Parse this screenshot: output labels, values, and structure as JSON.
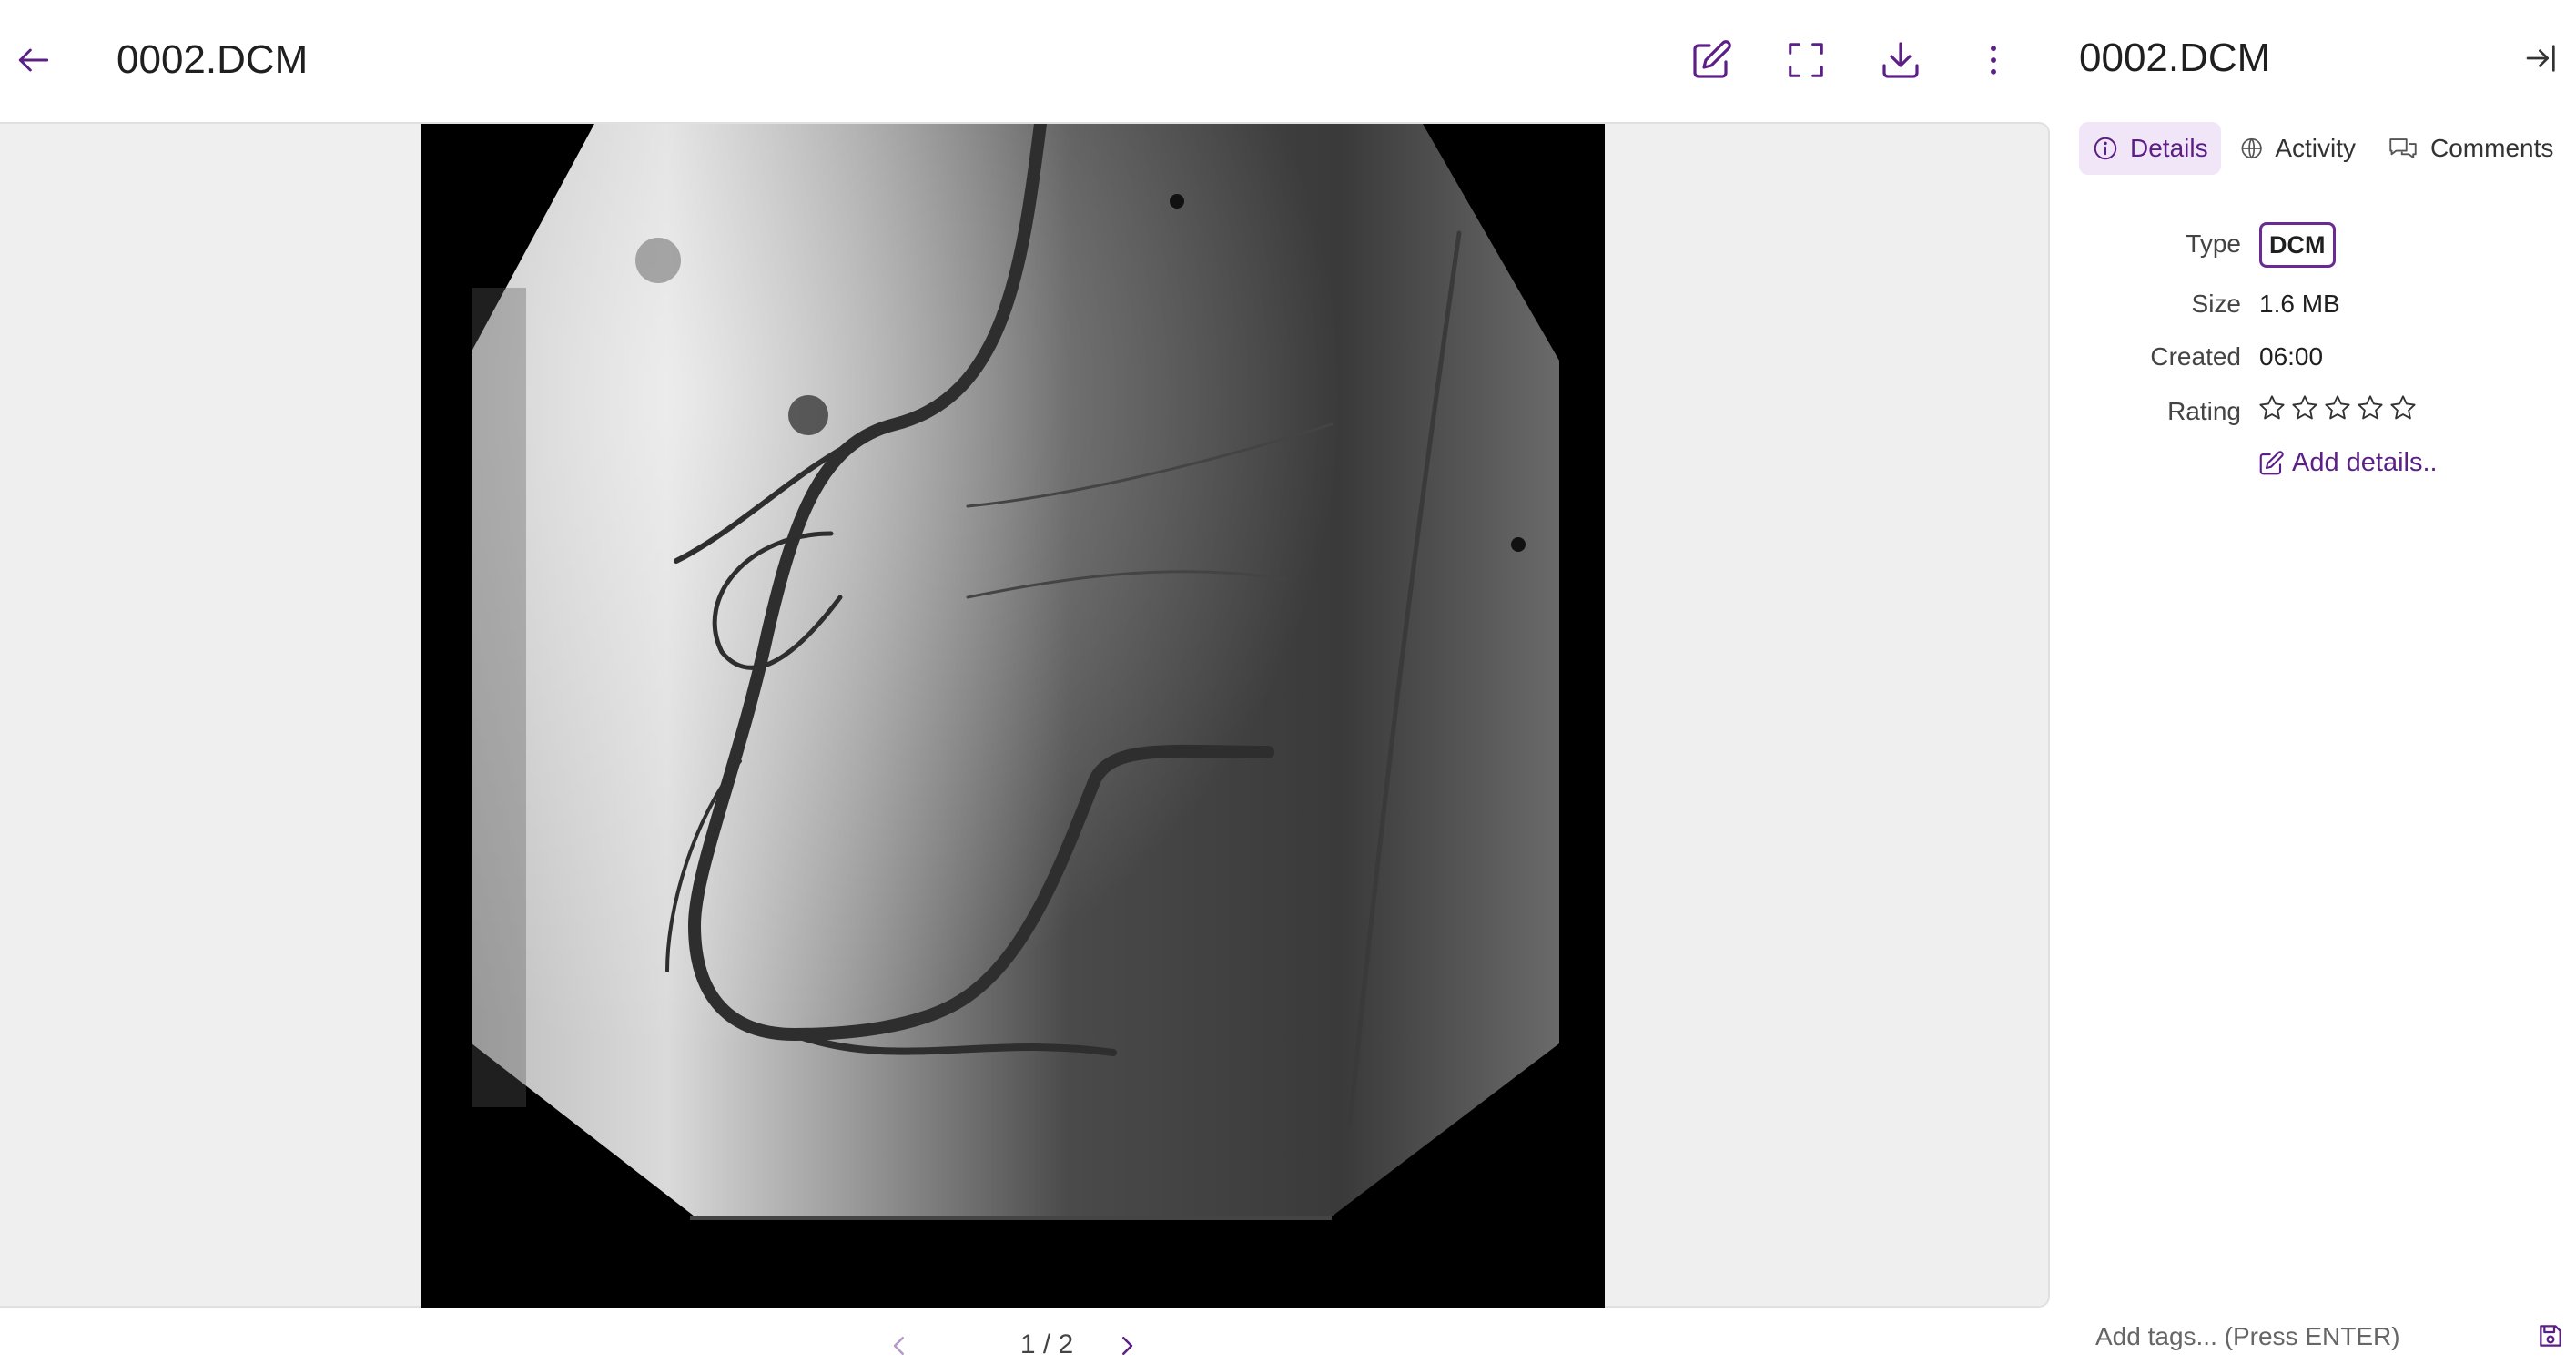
{
  "viewer": {
    "title": "0002.DCM",
    "image_alt": "Coronary angiogram (DICOM image)",
    "pager": {
      "text": "1 / 2"
    }
  },
  "toolbar": {
    "back_icon": "arrow-left-icon",
    "edit_icon": "edit-icon",
    "fullscreen_icon": "fullscreen-icon",
    "download_icon": "download-icon",
    "more_icon": "more-vertical-icon"
  },
  "panel": {
    "title": "0002.DCM",
    "collapse_icon": "collapse-panel-icon",
    "tabs": [
      {
        "label": "Details",
        "icon": "info-icon",
        "active": true
      },
      {
        "label": "Activity",
        "icon": "globe-icon",
        "active": false
      },
      {
        "label": "Comments",
        "icon": "comments-icon",
        "active": false
      }
    ],
    "details": {
      "type_label": "Type",
      "type_value": "DCM",
      "size_label": "Size",
      "size_value": "1.6 MB",
      "created_label": "Created",
      "created_value": "06:00",
      "rating_label": "Rating",
      "rating_value": 0,
      "rating_max": 5,
      "add_details": "Add details.."
    },
    "tags": {
      "placeholder": "Add tags... (Press ENTER)",
      "save_icon": "save-icon"
    }
  },
  "colors": {
    "accent": "#5b1f86",
    "accent_light": "#f0e6f7",
    "viewer_bg": "#efefef"
  }
}
